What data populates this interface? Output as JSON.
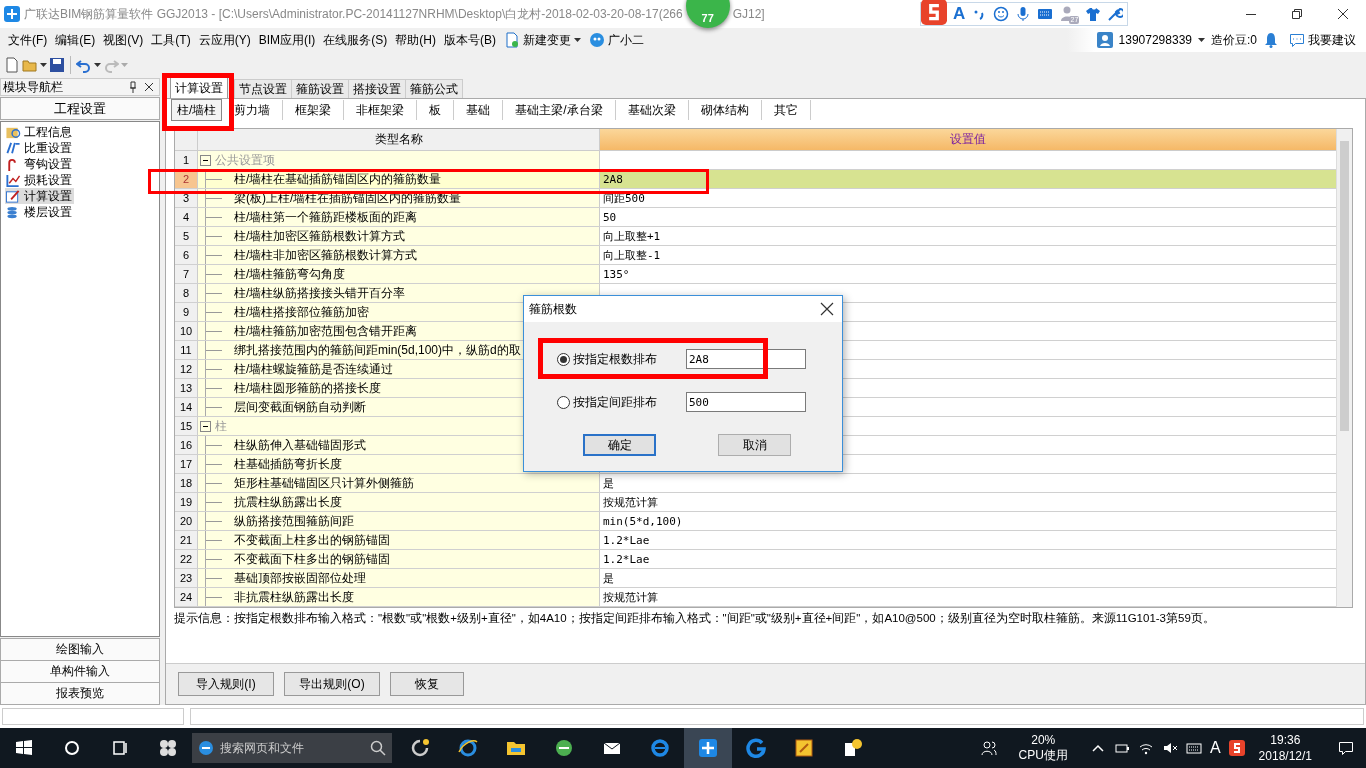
{
  "title_bar": {
    "title": "广联达BIM钢筋算量软件 GGJ2013 - [C:\\Users\\Administrator.PC-20141127NRHM\\Desktop\\白龙村-2018-02-03-20-08-17(266",
    "title_tail": "GJ12]"
  },
  "speed_ball": {
    "value": "77"
  },
  "ime_bar": {
    "mode": "A",
    "badge": "27"
  },
  "menu": [
    "文件(F)",
    "编辑(E)",
    "视图(V)",
    "工具(T)",
    "云应用(Y)",
    "BIM应用(I)",
    "在线服务(S)",
    "帮助(H)",
    "版本号(B)"
  ],
  "menu_extras": [
    {
      "label": "新建变更",
      "kind": "dropdown"
    },
    {
      "label": "广小二",
      "kind": "assistant"
    }
  ],
  "account": {
    "phone": "13907298339",
    "beans": "造价豆:0",
    "suggest": "我要建议"
  },
  "nav": {
    "title": "模块导航栏",
    "section": "工程设置",
    "items": [
      {
        "label": "工程信息",
        "selected": false
      },
      {
        "label": "比重设置",
        "selected": false
      },
      {
        "label": "弯钩设置",
        "selected": false
      },
      {
        "label": "损耗设置",
        "selected": false
      },
      {
        "label": "计算设置",
        "selected": true
      },
      {
        "label": "楼层设置",
        "selected": false
      }
    ],
    "bottom": [
      "绘图输入",
      "单构件输入",
      "报表预览"
    ]
  },
  "tabs": [
    {
      "label": "计算设置",
      "selected": true
    },
    {
      "label": "节点设置",
      "selected": false
    },
    {
      "label": "箍筋设置",
      "selected": false
    },
    {
      "label": "搭接设置",
      "selected": false
    },
    {
      "label": "箍筋公式",
      "selected": false
    }
  ],
  "subtabs": [
    {
      "label": "柱/墙柱",
      "selected": true
    },
    {
      "label": "剪力墙",
      "selected": false
    },
    {
      "label": "框架梁",
      "selected": false
    },
    {
      "label": "非框架梁",
      "selected": false
    },
    {
      "label": "板",
      "selected": false
    },
    {
      "label": "基础",
      "selected": false
    },
    {
      "label": "基础主梁/承台梁",
      "selected": false
    },
    {
      "label": "基础次梁",
      "selected": false
    },
    {
      "label": "砌体结构",
      "selected": false
    },
    {
      "label": "其它",
      "selected": false
    }
  ],
  "table": {
    "columns": [
      "类型名称",
      "设置值"
    ],
    "rows": [
      {
        "no": "1",
        "kind": "group",
        "name": "公共设置项",
        "selected": false
      },
      {
        "no": "2",
        "kind": "item",
        "name": "柱/墙柱在基础插筋锚固区内的箍筋数量",
        "value": "2A8",
        "selected": true
      },
      {
        "no": "3",
        "kind": "item",
        "name": "梁(板)上柱/墙柱在插筋锚固区内的箍筋数量",
        "value": "间距500",
        "selected": false
      },
      {
        "no": "4",
        "kind": "item",
        "name": "柱/墙柱第一个箍筋距楼板面的距离",
        "value": "50",
        "selected": false
      },
      {
        "no": "5",
        "kind": "item",
        "name": "柱/墙柱加密区箍筋根数计算方式",
        "value": "向上取整+1",
        "selected": false
      },
      {
        "no": "6",
        "kind": "item",
        "name": "柱/墙柱非加密区箍筋根数计算方式",
        "value": "向上取整-1",
        "selected": false
      },
      {
        "no": "7",
        "kind": "item",
        "name": "柱/墙柱箍筋弯勾角度",
        "value": "135°",
        "selected": false
      },
      {
        "no": "8",
        "kind": "item",
        "name": "柱/墙柱纵筋搭接接头错开百分率",
        "selected": false
      },
      {
        "no": "9",
        "kind": "item",
        "name": "柱/墙柱搭接部位箍筋加密",
        "selected": false
      },
      {
        "no": "10",
        "kind": "item",
        "name": "柱/墙柱箍筋加密范围包含错开距离",
        "selected": false
      },
      {
        "no": "11",
        "kind": "item",
        "name": "绑扎搭接范围内的箍筋间距min(5d,100)中，纵筋d的取",
        "selected": false
      },
      {
        "no": "12",
        "kind": "item",
        "name": "柱/墙柱螺旋箍筋是否连续通过",
        "selected": false
      },
      {
        "no": "13",
        "kind": "item",
        "name": "柱/墙柱圆形箍筋的搭接长度",
        "selected": false
      },
      {
        "no": "14",
        "kind": "item",
        "name": "层间变截面钢筋自动判断",
        "selected": false
      },
      {
        "no": "15",
        "kind": "group",
        "name": "柱",
        "selected": false
      },
      {
        "no": "16",
        "kind": "item",
        "name": "柱纵筋伸入基础锚固形式",
        "selected": false
      },
      {
        "no": "17",
        "kind": "item",
        "name": "柱基础插筋弯折长度",
        "selected": false
      },
      {
        "no": "18",
        "kind": "item",
        "name": "矩形柱基础锚固区只计算外侧箍筋",
        "value": "是",
        "selected": false
      },
      {
        "no": "19",
        "kind": "item",
        "name": "抗震柱纵筋露出长度",
        "value": "按规范计算",
        "selected": false
      },
      {
        "no": "20",
        "kind": "item",
        "name": "纵筋搭接范围箍筋间距",
        "value": "min(5*d,100)",
        "selected": false
      },
      {
        "no": "21",
        "kind": "item",
        "name": "不变截面上柱多出的钢筋锚固",
        "value": "1.2*Lae",
        "selected": false
      },
      {
        "no": "22",
        "kind": "item",
        "name": "不变截面下柱多出的钢筋锚固",
        "value": "1.2*Lae",
        "selected": false
      },
      {
        "no": "23",
        "kind": "item",
        "name": "基础顶部按嵌固部位处理",
        "value": "是",
        "selected": false
      },
      {
        "no": "24",
        "kind": "item",
        "name": "非抗震柱纵筋露出长度",
        "value": "按规范计算",
        "selected": false
      }
    ]
  },
  "hint": "提示信息：按指定根数排布输入格式：\"根数\"或\"根数+级别+直径\"，如4A10；按指定间距排布输入格式：\"间距\"或\"级别+直径+间距\"，如A10@500；级别直径为空时取柱箍筋。来源11G101-3第59页。",
  "buttons": [
    "导入规则(I)",
    "导出规则(O)",
    "恢复"
  ],
  "dialog": {
    "title": "箍筋根数",
    "options": [
      {
        "label": "按指定根数排布",
        "selected": true,
        "value": "2A8"
      },
      {
        "label": "按指定间距排布",
        "selected": false,
        "value": "500"
      }
    ],
    "buttons": [
      "确定",
      "取消"
    ]
  },
  "taskbar": {
    "search_placeholder": "搜索网页和文件",
    "cpu": "20%",
    "cpu_label": "CPU使用",
    "ime": "A",
    "time": "19:36",
    "date": "2018/12/1"
  }
}
